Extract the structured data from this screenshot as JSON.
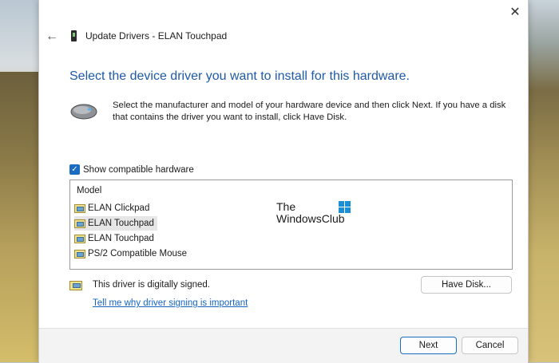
{
  "window": {
    "title": "Update Drivers - ELAN Touchpad",
    "close_glyph": "✕",
    "back_glyph": "←"
  },
  "main": {
    "heading": "Select the device driver you want to install for this hardware.",
    "description": "Select the manufacturer and model of your hardware device and then click Next. If you have a disk that contains the driver you want to install, click Have Disk.",
    "show_compatible": {
      "label": "Show compatible hardware",
      "checked": true
    },
    "model_list": {
      "header": "Model",
      "items": [
        {
          "label": "ELAN Clickpad",
          "selected": false
        },
        {
          "label": "ELAN Touchpad",
          "selected": true
        },
        {
          "label": "ELAN Touchpad",
          "selected": false
        },
        {
          "label": "PS/2 Compatible Mouse",
          "selected": false
        }
      ]
    },
    "watermark": {
      "line1": "The",
      "line2": "WindowsClub"
    },
    "signed_text": "This driver is digitally signed.",
    "signing_link": "Tell me why driver signing is important",
    "have_disk_label": "Have Disk..."
  },
  "footer": {
    "next_label": "Next",
    "cancel_label": "Cancel"
  },
  "colors": {
    "heading": "#1e5aa8",
    "link": "#1565c0",
    "accent": "#1a6dc0"
  }
}
